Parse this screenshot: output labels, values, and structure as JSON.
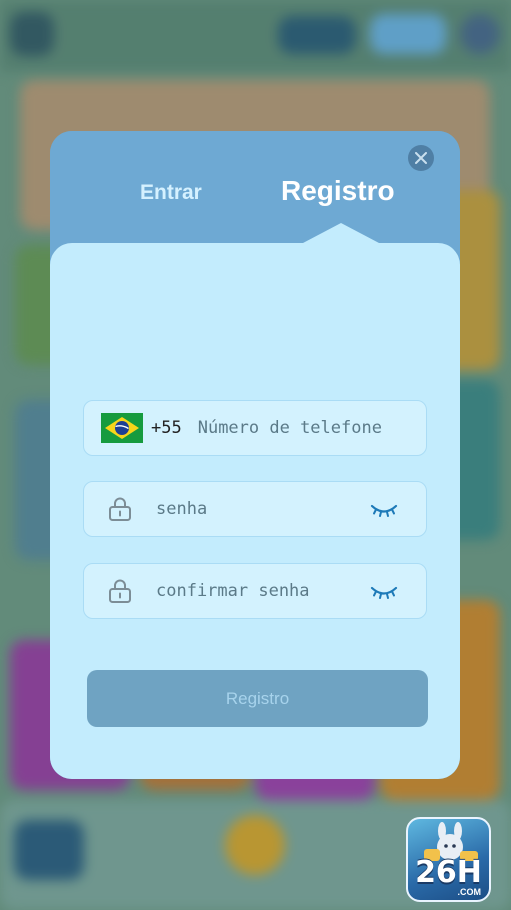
{
  "modal": {
    "tab_login": "Entrar",
    "tab_register": "Registro",
    "phone": {
      "country_code": "+55",
      "placeholder": "Número de telefone",
      "flag": "brazil-flag-icon"
    },
    "password": {
      "placeholder": "senha"
    },
    "confirm_password": {
      "placeholder": "confirmar senha"
    },
    "submit_label": "Registro"
  },
  "logo": {
    "text": "26H",
    "sub": ".COM"
  },
  "colors": {
    "header": "#6ea9d3",
    "body": "#c3ecfd",
    "button": "#6fa3c2",
    "eye": "#1d7ab8"
  }
}
